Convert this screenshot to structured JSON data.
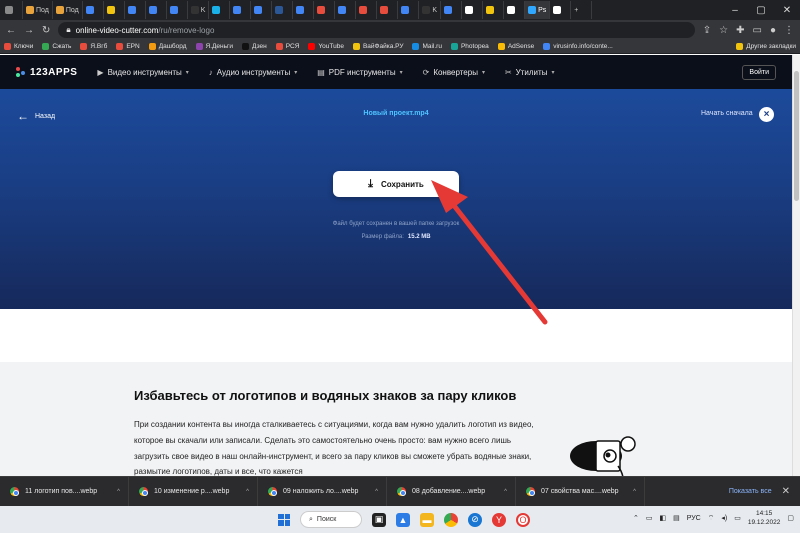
{
  "browser": {
    "tabs": [
      {
        "label": "",
        "color": "#8a8a8a"
      },
      {
        "label": "Под",
        "color": "#e8a33c"
      },
      {
        "label": "Под",
        "color": "#e8a33c"
      },
      {
        "label": "",
        "color": "#4285f4"
      },
      {
        "label": "",
        "color": "#f1c40f"
      },
      {
        "label": "",
        "color": "#4285f4"
      },
      {
        "label": "",
        "color": "#4285f4"
      },
      {
        "label": "",
        "color": "#4285f4"
      },
      {
        "label": "K",
        "color": "#333333"
      },
      {
        "label": "",
        "color": "#1ab0e8"
      },
      {
        "label": "",
        "color": "#4285f4"
      },
      {
        "label": "",
        "color": "#4285f4"
      },
      {
        "label": "",
        "color": "#2b5797"
      },
      {
        "label": "",
        "color": "#4285f4"
      },
      {
        "label": "",
        "color": "#e74c3c"
      },
      {
        "label": "",
        "color": "#4285f4"
      },
      {
        "label": "",
        "color": "#e74c3c"
      },
      {
        "label": "",
        "color": "#e74c3c"
      },
      {
        "label": "",
        "color": "#4285f4"
      },
      {
        "label": "K",
        "color": "#333333"
      },
      {
        "label": "",
        "color": "#4285f4"
      },
      {
        "label": "",
        "color": "#ffffff"
      },
      {
        "label": "",
        "color": "#f1c40f"
      },
      {
        "label": "",
        "color": "#ffffff"
      },
      {
        "label": "Ps",
        "color": "#31a8ff"
      },
      {
        "label": "",
        "color": "#ffffff"
      }
    ],
    "active_tab_index": 24,
    "url_host": "online-video-cutter.com",
    "url_path": "/ru/remove-logo",
    "bookmarks": [
      {
        "label": "Ключи",
        "color": "#e74c3c"
      },
      {
        "label": "Сжать",
        "color": "#34a853"
      },
      {
        "label": "Я.Вгб",
        "color": "#e74c3c"
      },
      {
        "label": "EPN",
        "color": "#e74c3c"
      },
      {
        "label": "Дашборд",
        "color": "#f39c12"
      },
      {
        "label": "Я.Деньги",
        "color": "#8e44ad"
      },
      {
        "label": "Дзен",
        "color": "#111111"
      },
      {
        "label": "РСЯ",
        "color": "#e74c3c"
      },
      {
        "label": "YouTube",
        "color": "#ff0000"
      },
      {
        "label": "ВайФайка.РУ",
        "color": "#f1c40f"
      },
      {
        "label": "Mail.ru",
        "color": "#168de2"
      },
      {
        "label": "Photopea",
        "color": "#18a497"
      },
      {
        "label": "AdSense",
        "color": "#fbbc05"
      },
      {
        "label": "virusinfo.info/conte...",
        "color": "#4285f4"
      }
    ],
    "other_bookmarks": "Другие закладки"
  },
  "site": {
    "brand": "123APPS",
    "nav": [
      {
        "label": "Видео инструменты",
        "icon": "video-icon"
      },
      {
        "label": "Аудио инструменты",
        "icon": "audio-icon"
      },
      {
        "label": "PDF инструменты",
        "icon": "pdf-icon"
      },
      {
        "label": "Конвертеры",
        "icon": "converter-icon"
      },
      {
        "label": "Утилиты",
        "icon": "tools-icon"
      }
    ],
    "login": "Войти"
  },
  "editor": {
    "back": "Назад",
    "project_name": "Новый проект.mp4",
    "restart": "Начать сначала",
    "save": "Сохранить",
    "hint": "Файл будет сохранен в вашей папке загрузок",
    "size_label": "Размер файла:",
    "size_value": "15.2 MB"
  },
  "article": {
    "title": "Избавьтесь от логотипов и водяных знаков за пару кликов",
    "body": "При создании контента вы иногда сталкиваетесь с ситуациями, когда вам нужно удалить логотип из видео, которое вы скачали или записали. Сделать это самостоятельно очень просто: вам нужно всего лишь загрузить свое видео в наш онлайн-инструмент, и всего за пару кликов вы сможете убрать водяные знаки, размытие логотипов, даты и все, что кажется"
  },
  "downloads": {
    "items": [
      "11 логотип пов....webp",
      "10 изменение р....webp",
      "09 наложить ло....webp",
      "08 добавление....webp",
      "07 свойства мас....webp"
    ],
    "show_all": "Показать все"
  },
  "taskbar": {
    "search": "Поиск",
    "lang": "РУС",
    "time": "14:15",
    "date": "19.12.2022"
  },
  "colors": {
    "hero_top": "#1c4a9b",
    "hero_bottom": "#16295b",
    "accent": "#4fc3ff",
    "arrow": "#e53935"
  }
}
